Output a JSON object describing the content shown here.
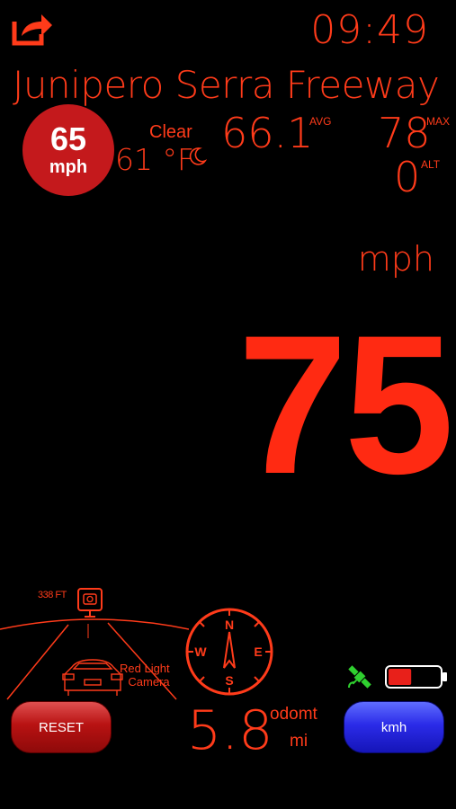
{
  "header": {
    "time": "09:49",
    "share_icon": "share-icon"
  },
  "road": {
    "name": "Junipero Serra Freeway"
  },
  "speed_limit": {
    "value": "65",
    "unit": "mph"
  },
  "weather": {
    "condition": "Clear",
    "temperature": "61 °F",
    "icon": "moon-icon"
  },
  "stats": {
    "avg_value": "66.1",
    "avg_label": "AVG",
    "max_value": "78",
    "max_label": "MAX",
    "alt_value": "0",
    "alt_label": "ALT"
  },
  "speed": {
    "value": "75",
    "unit": "mph"
  },
  "camera_alert": {
    "distance": "338 FT",
    "label_line1": "Red Light",
    "label_line2": "Camera"
  },
  "compass": {
    "n": "N",
    "e": "E",
    "s": "S",
    "w": "W"
  },
  "odometer": {
    "value": "5.8",
    "label_line1": "odomt",
    "label_line2": "mi"
  },
  "buttons": {
    "reset": "RESET",
    "units": "kmh"
  },
  "status": {
    "gps_icon": "satellite-icon",
    "battery_level": 0.45
  },
  "colors": {
    "accent": "#ff3b1a",
    "limit_badge": "#c4191c",
    "reset_button": "#b81212",
    "units_button": "#2b2be8"
  }
}
